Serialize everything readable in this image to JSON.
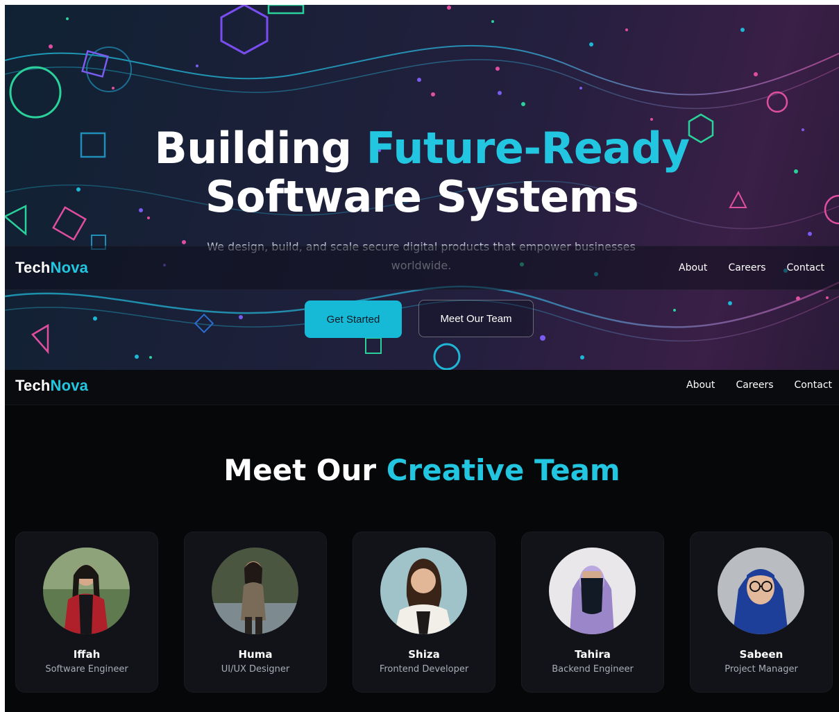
{
  "hero": {
    "title_line1_white": "Building ",
    "title_line1_accent": "Future-Ready",
    "title_line2": "Software Systems",
    "subtitle": "We design, build, and scale secure digital products that empower businesses worldwide.",
    "primary_button": "Get Started",
    "secondary_button": "Meet Our Team"
  },
  "brand": {
    "part1": "Tech",
    "part2": "Nova",
    "accent_color": "#23c6e0"
  },
  "nav": {
    "about": "About",
    "careers": "Careers",
    "contact": "Contact"
  },
  "team": {
    "title_white": "Meet Our ",
    "title_accent": "Creative Team",
    "members": [
      {
        "name": "Iffah",
        "role": "Software Engineer"
      },
      {
        "name": "Huma",
        "role": "UI/UX Designer"
      },
      {
        "name": "Shiza",
        "role": "Frontend Developer"
      },
      {
        "name": "Tahira",
        "role": "Backend Engineer"
      },
      {
        "name": "Sabeen",
        "role": "Project Manager"
      }
    ]
  }
}
